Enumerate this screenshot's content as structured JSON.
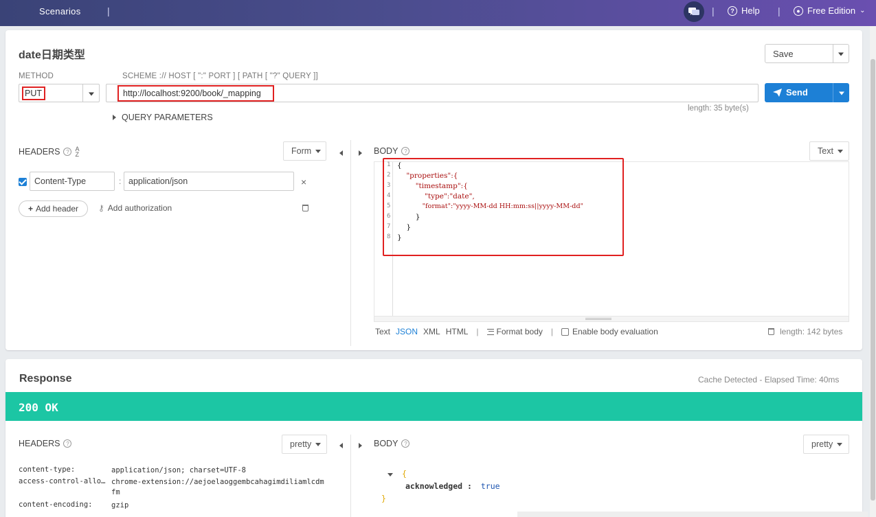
{
  "topbar": {
    "scenarios_label": "Scenarios",
    "separator": "|",
    "help_label": "Help",
    "edition_label": "Free Edition"
  },
  "request": {
    "title": "date日期类型",
    "save_label": "Save",
    "method_label": "METHOD",
    "method_value": "PUT",
    "scheme_label": "SCHEME :// HOST [ \":\" PORT ] [ PATH [ \"?\" QUERY ]]",
    "url_value": "http://localhost:9200/book/_mapping",
    "send_label": "Send",
    "url_length": "length: 35 byte(s)",
    "query_params_label": "QUERY PARAMETERS",
    "headers_label": "HEADERS",
    "headers_mode": "Form",
    "body_label": "BODY",
    "body_mode": "Text",
    "header_rows": [
      {
        "name": "Content-Type",
        "value": "application/json",
        "enabled": true
      }
    ],
    "add_header_label": "Add header",
    "add_auth_label": "Add authorization",
    "body_lines": [
      {
        "n": "1",
        "text": "{"
      },
      {
        "n": "2",
        "text": "    \"properties\":{"
      },
      {
        "n": "3",
        "text": "        \"timestamp\":{"
      },
      {
        "n": "4",
        "text": "            \"type\":\"date\","
      },
      {
        "n": "5",
        "text": "            \"format\":\"yyyy-MM-dd HH:mm:ss||yyyy-MM-dd\""
      },
      {
        "n": "6",
        "text": "        }"
      },
      {
        "n": "7",
        "text": "    }"
      },
      {
        "n": "8",
        "text": "}"
      }
    ],
    "body_formats": [
      "Text",
      "JSON",
      "XML",
      "HTML"
    ],
    "body_format_active": "JSON",
    "format_body_label": "Format body",
    "enable_eval_label": "Enable body evaluation",
    "body_length": "length: 142 bytes"
  },
  "response": {
    "title": "Response",
    "cache_info": "Cache Detected - Elapsed Time: 40ms",
    "status": "200 OK",
    "status_color": "#1cc6a4",
    "headers_label": "HEADERS",
    "headers_mode": "pretty",
    "body_label": "BODY",
    "body_mode": "pretty",
    "headers": [
      {
        "key": "content-type:",
        "value": "application/json; charset=UTF-8"
      },
      {
        "key": "access-control-allo…",
        "value": "chrome-extension://aejoelaoggembcahagimdiliamlcdmfm"
      },
      {
        "key": "content-encoding:",
        "value": "gzip"
      }
    ],
    "body": {
      "open_brace": "{",
      "key": "acknowledged :",
      "value": "true",
      "close_brace": "}"
    }
  },
  "colors": {
    "accent": "#1d80d6",
    "highlight": "#e02020",
    "topbar_start": "#3a4377",
    "topbar_end": "#6a4fb0"
  }
}
